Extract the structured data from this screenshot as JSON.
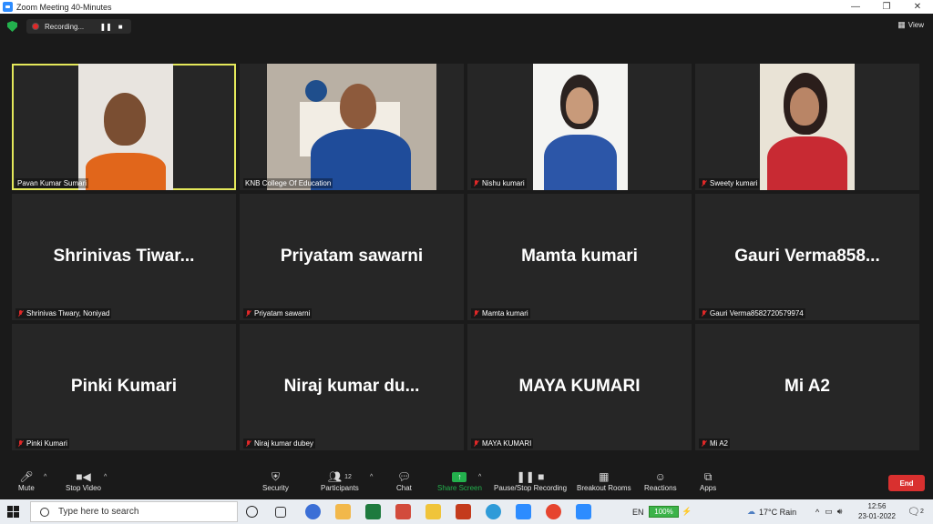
{
  "window": {
    "title": "Zoom Meeting 40-Minutes",
    "controls": [
      "—",
      "❐",
      "✕"
    ]
  },
  "topbar": {
    "recording_label": "Recording...",
    "view_label": "View"
  },
  "tiles": [
    {
      "name": "Pavan Kumar Sumari",
      "has_video": true,
      "muted": false
    },
    {
      "name": "KNB College Of Education",
      "has_video": true,
      "muted": false
    },
    {
      "name": "Nishu kumari",
      "has_video": true,
      "muted": true
    },
    {
      "name": "Sweety kumari",
      "has_video": true,
      "muted": true
    },
    {
      "name": "Shrinivas Tiwary, Noniyad",
      "display": "Shrinivas  Tiwar...",
      "has_video": false,
      "muted": true
    },
    {
      "name": "Priyatam sawarni",
      "display": "Priyatam sawarni",
      "has_video": false,
      "muted": true
    },
    {
      "name": "Mamta kumari",
      "display": "Mamta kumari",
      "has_video": false,
      "muted": true
    },
    {
      "name": "Gauri Verma8582720579974",
      "display": "Gauri  Verma858...",
      "has_video": false,
      "muted": true
    },
    {
      "name": "Pinki Kumari",
      "display": "Pinki Kumari",
      "has_video": false,
      "muted": true
    },
    {
      "name": "Niraj kumar dubey",
      "display": "Niraj  kumar  du...",
      "has_video": false,
      "muted": true
    },
    {
      "name": "MAYA KUMARI",
      "display": "MAYA KUMARI",
      "has_video": false,
      "muted": true
    },
    {
      "name": "Mi A2",
      "display": "Mi A2",
      "has_video": false,
      "muted": true
    }
  ],
  "toolbar": {
    "mute": "Mute",
    "stop_video": "Stop Video",
    "security": "Security",
    "participants": "Participants",
    "participants_count": "12",
    "chat": "Chat",
    "share_screen": "Share Screen",
    "pause_stop_recording": "Pause/Stop Recording",
    "breakout_rooms": "Breakout Rooms",
    "reactions": "Reactions",
    "apps": "Apps",
    "end": "End"
  },
  "taskbar": {
    "search_placeholder": "Type here to search",
    "language": "EN",
    "battery": "100%",
    "weather": "17°C  Rain",
    "time": "12:56",
    "date": "23-01-2022",
    "notifications": "2"
  },
  "colors": {
    "active_speaker": "#e4e85a",
    "share_green": "#23b14d",
    "end_red": "#d9302f",
    "muted_red": "#e02828"
  }
}
